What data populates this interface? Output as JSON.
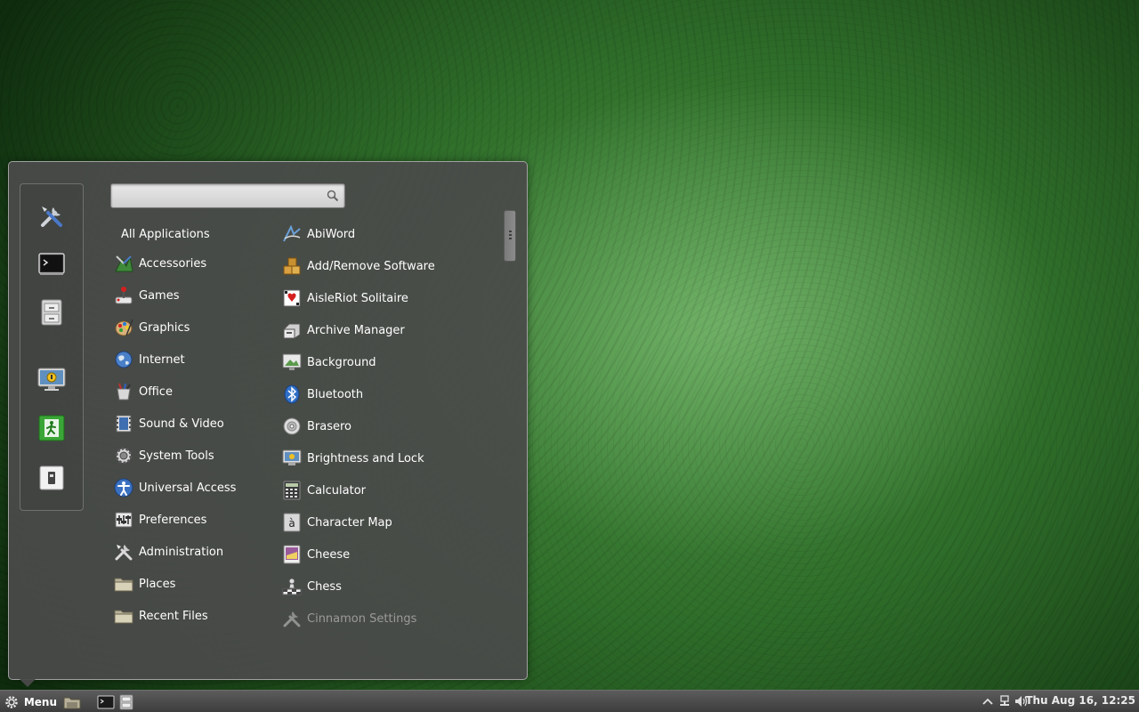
{
  "search": {
    "placeholder": "",
    "value": ""
  },
  "favorites": [
    {
      "icon": "tools-icon"
    },
    {
      "icon": "terminal-icon"
    },
    {
      "icon": "file-cabinet-icon"
    },
    {
      "icon": "lock-screen-icon"
    },
    {
      "icon": "logout-icon"
    },
    {
      "icon": "shutdown-icon"
    }
  ],
  "categories": [
    {
      "label": "All Applications",
      "icon": ""
    },
    {
      "label": "Accessories",
      "icon": "accessories-icon"
    },
    {
      "label": "Games",
      "icon": "games-icon"
    },
    {
      "label": "Graphics",
      "icon": "graphics-icon"
    },
    {
      "label": "Internet",
      "icon": "internet-icon"
    },
    {
      "label": "Office",
      "icon": "office-icon"
    },
    {
      "label": "Sound & Video",
      "icon": "sound-video-icon"
    },
    {
      "label": "System Tools",
      "icon": "system-tools-icon"
    },
    {
      "label": "Universal Access",
      "icon": "universal-access-icon"
    },
    {
      "label": "Preferences",
      "icon": "preferences-icon"
    },
    {
      "label": "Administration",
      "icon": "administration-icon"
    },
    {
      "label": "Places",
      "icon": "folder-icon"
    },
    {
      "label": "Recent Files",
      "icon": "folder-icon"
    }
  ],
  "apps": [
    {
      "label": "AbiWord",
      "icon": "abiword-icon"
    },
    {
      "label": "Add/Remove Software",
      "icon": "software-icon"
    },
    {
      "label": "AisleRiot Solitaire",
      "icon": "cards-icon"
    },
    {
      "label": "Archive Manager",
      "icon": "archive-icon"
    },
    {
      "label": "Background",
      "icon": "background-icon"
    },
    {
      "label": "Bluetooth",
      "icon": "bluetooth-icon"
    },
    {
      "label": "Brasero",
      "icon": "disc-icon"
    },
    {
      "label": "Brightness and Lock",
      "icon": "brightness-icon"
    },
    {
      "label": "Calculator",
      "icon": "calculator-icon"
    },
    {
      "label": "Character Map",
      "icon": "character-map-icon"
    },
    {
      "label": "Cheese",
      "icon": "cheese-icon"
    },
    {
      "label": "Chess",
      "icon": "chess-icon"
    },
    {
      "label": "Cinnamon Settings",
      "icon": "settings-icon"
    }
  ],
  "taskbar": {
    "menu_label": "Menu",
    "clock": "Thu Aug 16, 12:25"
  }
}
